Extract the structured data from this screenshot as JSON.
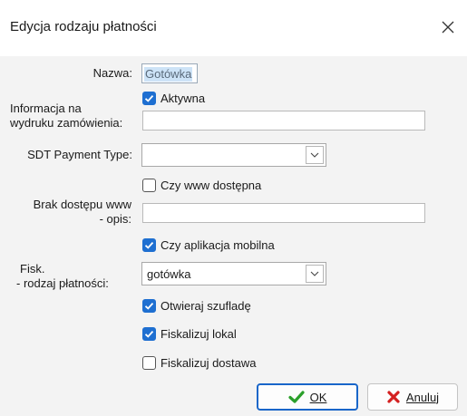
{
  "window": {
    "title": "Edycja rodzaju płatności"
  },
  "form": {
    "nazwa_label": "Nazwa:",
    "nazwa_value": "Gotówka",
    "aktywna_label": "Aktywna",
    "informacja_label_line1": "Informacja na",
    "informacja_label_line2": "wydruku zamówienia:",
    "informacja_value": "",
    "sdt_label": "SDT Payment Type:",
    "sdt_value": "",
    "czy_www_label": "Czy www dostępna",
    "brak_label_line1": "Brak dostępu www",
    "brak_label_line2": "- opis:",
    "brak_value": "",
    "czy_aplikacja_label": "Czy aplikacja mobilna",
    "fisk_label_line1": "Fisk.",
    "fisk_label_line2": "- rodzaj płatności:",
    "fisk_value": "gotówka",
    "otwieraj_label": "Otwieraj szufladę",
    "fisk_lokal_label": "Fiskalizuj lokal",
    "fisk_dostawa_label": "Fiskalizuj dostawa"
  },
  "checkboxes": {
    "aktywna": true,
    "czy_www": false,
    "czy_aplikacja": true,
    "otwieraj": true,
    "fisk_lokal": true,
    "fisk_dostawa": false
  },
  "buttons": {
    "ok_label": "OK",
    "cancel_label": "Anuluj"
  },
  "colors": {
    "accent": "#1e6fd1",
    "ok_icon": "#2ba02b",
    "cancel_icon": "#d42020"
  },
  "icons": {
    "close": "close-icon",
    "ok": "checkmark-icon",
    "cancel": "x-icon",
    "dropdown": "chevron-down-icon"
  }
}
